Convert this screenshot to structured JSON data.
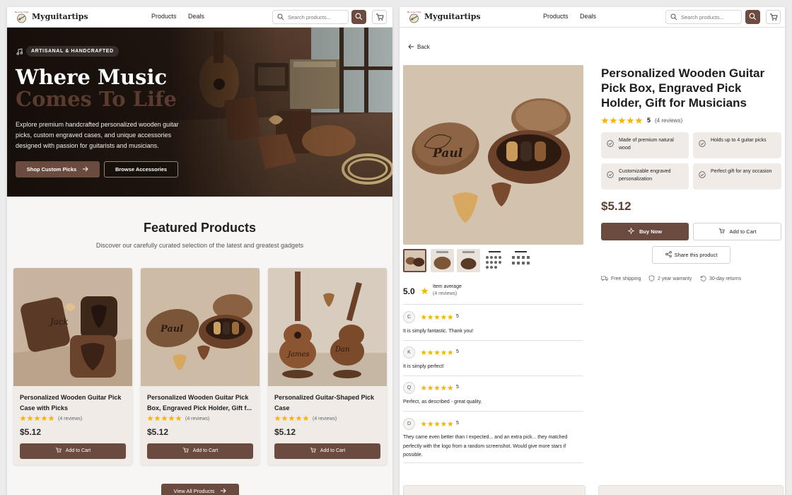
{
  "brand": "Myguitartips",
  "logo_text": "Be Love Tips",
  "nav": {
    "products": "Products",
    "deals": "Deals"
  },
  "search": {
    "placeholder": "Search products..."
  },
  "hero": {
    "kicker": "ARTISANAL & HANDCRAFTED",
    "title_line1": "Where Music",
    "title_line2": "Comes To Life",
    "description": "Explore premium handcrafted personalized wooden guitar picks, custom engraved cases, and unique accessories designed with passion for guitarists and musicians.",
    "primary_button": "Shop Custom Picks",
    "secondary_button": "Browse Accessories"
  },
  "featured": {
    "title": "Featured Products",
    "subtitle": "Discover our carefully curated selection of the latest and greatest gadgets",
    "view_all": "View All Products",
    "products": [
      {
        "title": "Personalized Wooden Guitar Pick Case with Picks",
        "reviews": "(4 reviews)",
        "price": "$5.12",
        "button": "Add to Cart",
        "rating": 5,
        "engraving": "Jack"
      },
      {
        "title": "Personalized Wooden Guitar Pick Box, Engraved Pick Holder, Gift f...",
        "reviews": "(4 reviews)",
        "price": "$5.12",
        "button": "Add to Cart",
        "rating": 5,
        "engraving": "Paul"
      },
      {
        "title": "Personalized Guitar-Shaped Pick Case",
        "reviews": "(4 reviews)",
        "price": "$5.12",
        "button": "Add to Cart",
        "rating": 5,
        "engraving": "James"
      }
    ]
  },
  "product": {
    "back": "Back",
    "title": "Personalized Wooden Guitar Pick Box, Engraved Pick Holder, Gift for Musicians",
    "rating": "5",
    "reviews": "(4 reviews)",
    "engraving": "Paul",
    "features": [
      "Made of premium natural wood",
      "Holds up to 4 guitar picks",
      "Customizable engraved personalization",
      "Perfect gift for any occasion"
    ],
    "price": "$5.12",
    "buy_now": "Buy Now",
    "add_to_cart": "Add to Cart",
    "share": "Share this product",
    "trust": [
      "Free shipping",
      "2 year warranty",
      "30-day returns"
    ],
    "average": {
      "score": "5.0",
      "label": "Item average",
      "count": "(4 reviews)"
    },
    "reviews_list": [
      {
        "initial": "C",
        "score": "5",
        "text": "It is simply fantastic. Thank you!"
      },
      {
        "initial": "K",
        "score": "5",
        "text": "It is simply perfect!"
      },
      {
        "initial": "Q",
        "score": "5",
        "text": "Perfect, as described - great quality."
      },
      {
        "initial": "D",
        "score": "5",
        "text": "They came even better than I expected... and an extra pick... they matched perfectly with the logo from a random screenshot. Would give more stars if possible."
      }
    ]
  },
  "colors": {
    "accent": "#6b4a3f",
    "star": "#f5b800",
    "price": "#5c4036"
  }
}
